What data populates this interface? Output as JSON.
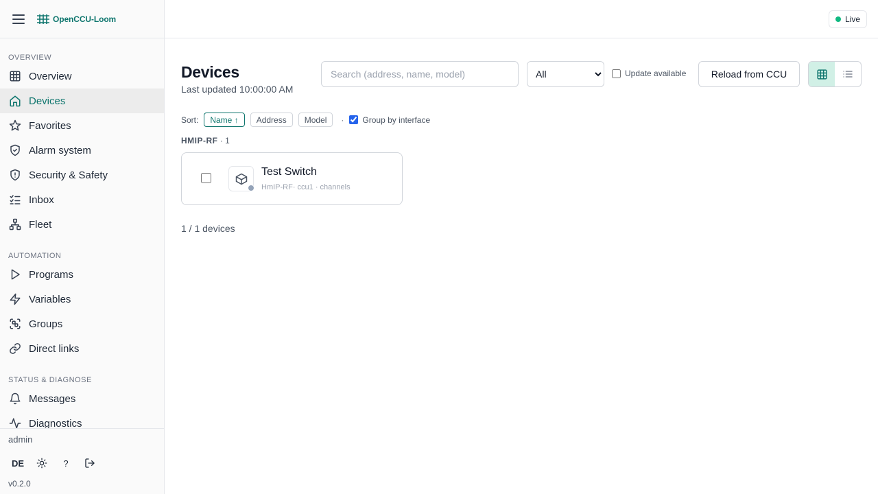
{
  "brand": {
    "name": "OpenCCU-Loom",
    "accent": "#0f766e"
  },
  "sidebar": {
    "sections": [
      {
        "label": "OVERVIEW",
        "items": [
          {
            "label": "Overview",
            "icon": "grid-icon"
          },
          {
            "label": "Devices",
            "icon": "home-icon",
            "active": true
          },
          {
            "label": "Favorites",
            "icon": "star-icon"
          },
          {
            "label": "Alarm system",
            "icon": "shield-check-icon"
          },
          {
            "label": "Security & Safety",
            "icon": "shield-alert-icon"
          },
          {
            "label": "Inbox",
            "icon": "list-checks-icon"
          },
          {
            "label": "Fleet",
            "icon": "network-icon"
          }
        ]
      },
      {
        "label": "AUTOMATION",
        "items": [
          {
            "label": "Programs",
            "icon": "play-icon"
          },
          {
            "label": "Variables",
            "icon": "zap-icon"
          },
          {
            "label": "Groups",
            "icon": "group-icon"
          },
          {
            "label": "Direct links",
            "icon": "link-icon"
          }
        ]
      },
      {
        "label": "STATUS & DIAGNOSE",
        "items": [
          {
            "label": "Messages",
            "icon": "bell-icon"
          },
          {
            "label": "Diagnostics",
            "icon": "activity-icon"
          }
        ]
      }
    ],
    "footer": {
      "user": "admin",
      "lang": "DE",
      "help": "?",
      "version": "v0.2.0"
    }
  },
  "topbar": {
    "status": "Live",
    "status_color": "#10b981"
  },
  "main": {
    "title": "Devices",
    "last_updated": "Last updated 10:00:00 AM",
    "search_placeholder": "Search (address, name, model)",
    "filter_value": "All",
    "update_available_label": "Update available",
    "reload_label": "Reload from CCU",
    "sort_label": "Sort:",
    "sort_options": [
      "Name ↑",
      "Address",
      "Model"
    ],
    "separator": "·",
    "group_by_label": "Group by interface",
    "group": {
      "name": "HMIP-RF",
      "count": "· 1"
    },
    "device": {
      "name": "Test Switch",
      "meta": "HmIP-RF· ccu1 ·  channels"
    },
    "device_count": "1 / 1 devices"
  }
}
